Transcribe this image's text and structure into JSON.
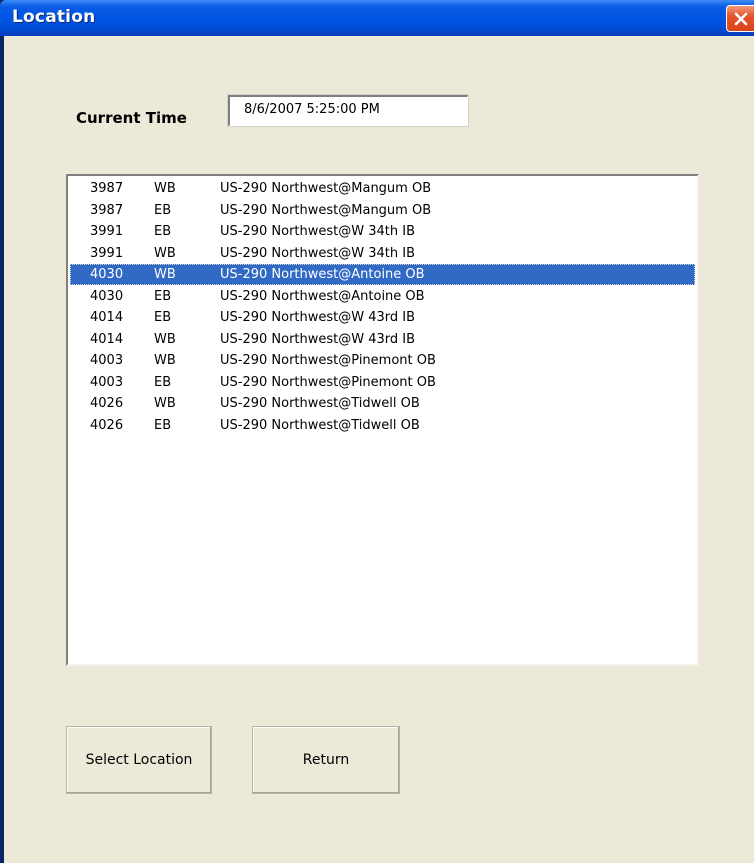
{
  "window": {
    "title": "Location",
    "close_icon": "close-icon"
  },
  "time": {
    "label": "Current Time",
    "value": "8/6/2007 5:25:00 PM"
  },
  "locations": {
    "selected_index": 4,
    "rows": [
      {
        "id": "3987",
        "dir": "WB",
        "loc": "US-290 Northwest@Mangum OB"
      },
      {
        "id": "3987",
        "dir": "EB",
        "loc": "US-290 Northwest@Mangum OB"
      },
      {
        "id": "3991",
        "dir": "EB",
        "loc": "US-290 Northwest@W 34th IB"
      },
      {
        "id": "3991",
        "dir": "WB",
        "loc": "US-290 Northwest@W 34th IB"
      },
      {
        "id": "4030",
        "dir": "WB",
        "loc": "US-290 Northwest@Antoine OB"
      },
      {
        "id": "4030",
        "dir": "EB",
        "loc": "US-290 Northwest@Antoine OB"
      },
      {
        "id": "4014",
        "dir": "EB",
        "loc": "US-290 Northwest@W 43rd IB"
      },
      {
        "id": "4014",
        "dir": "WB",
        "loc": "US-290 Northwest@W 43rd IB"
      },
      {
        "id": "4003",
        "dir": "WB",
        "loc": "US-290 Northwest@Pinemont OB"
      },
      {
        "id": "4003",
        "dir": "EB",
        "loc": "US-290 Northwest@Pinemont OB"
      },
      {
        "id": "4026",
        "dir": "WB",
        "loc": "US-290 Northwest@Tidwell OB"
      },
      {
        "id": "4026",
        "dir": "EB",
        "loc": "US-290 Northwest@Tidwell OB"
      }
    ]
  },
  "buttons": {
    "select_label": "Select Location",
    "return_label": "Return"
  },
  "colors": {
    "selection": "#316ac5",
    "titlebar": "#0054e3",
    "dialog_bg": "#ece9d8"
  }
}
